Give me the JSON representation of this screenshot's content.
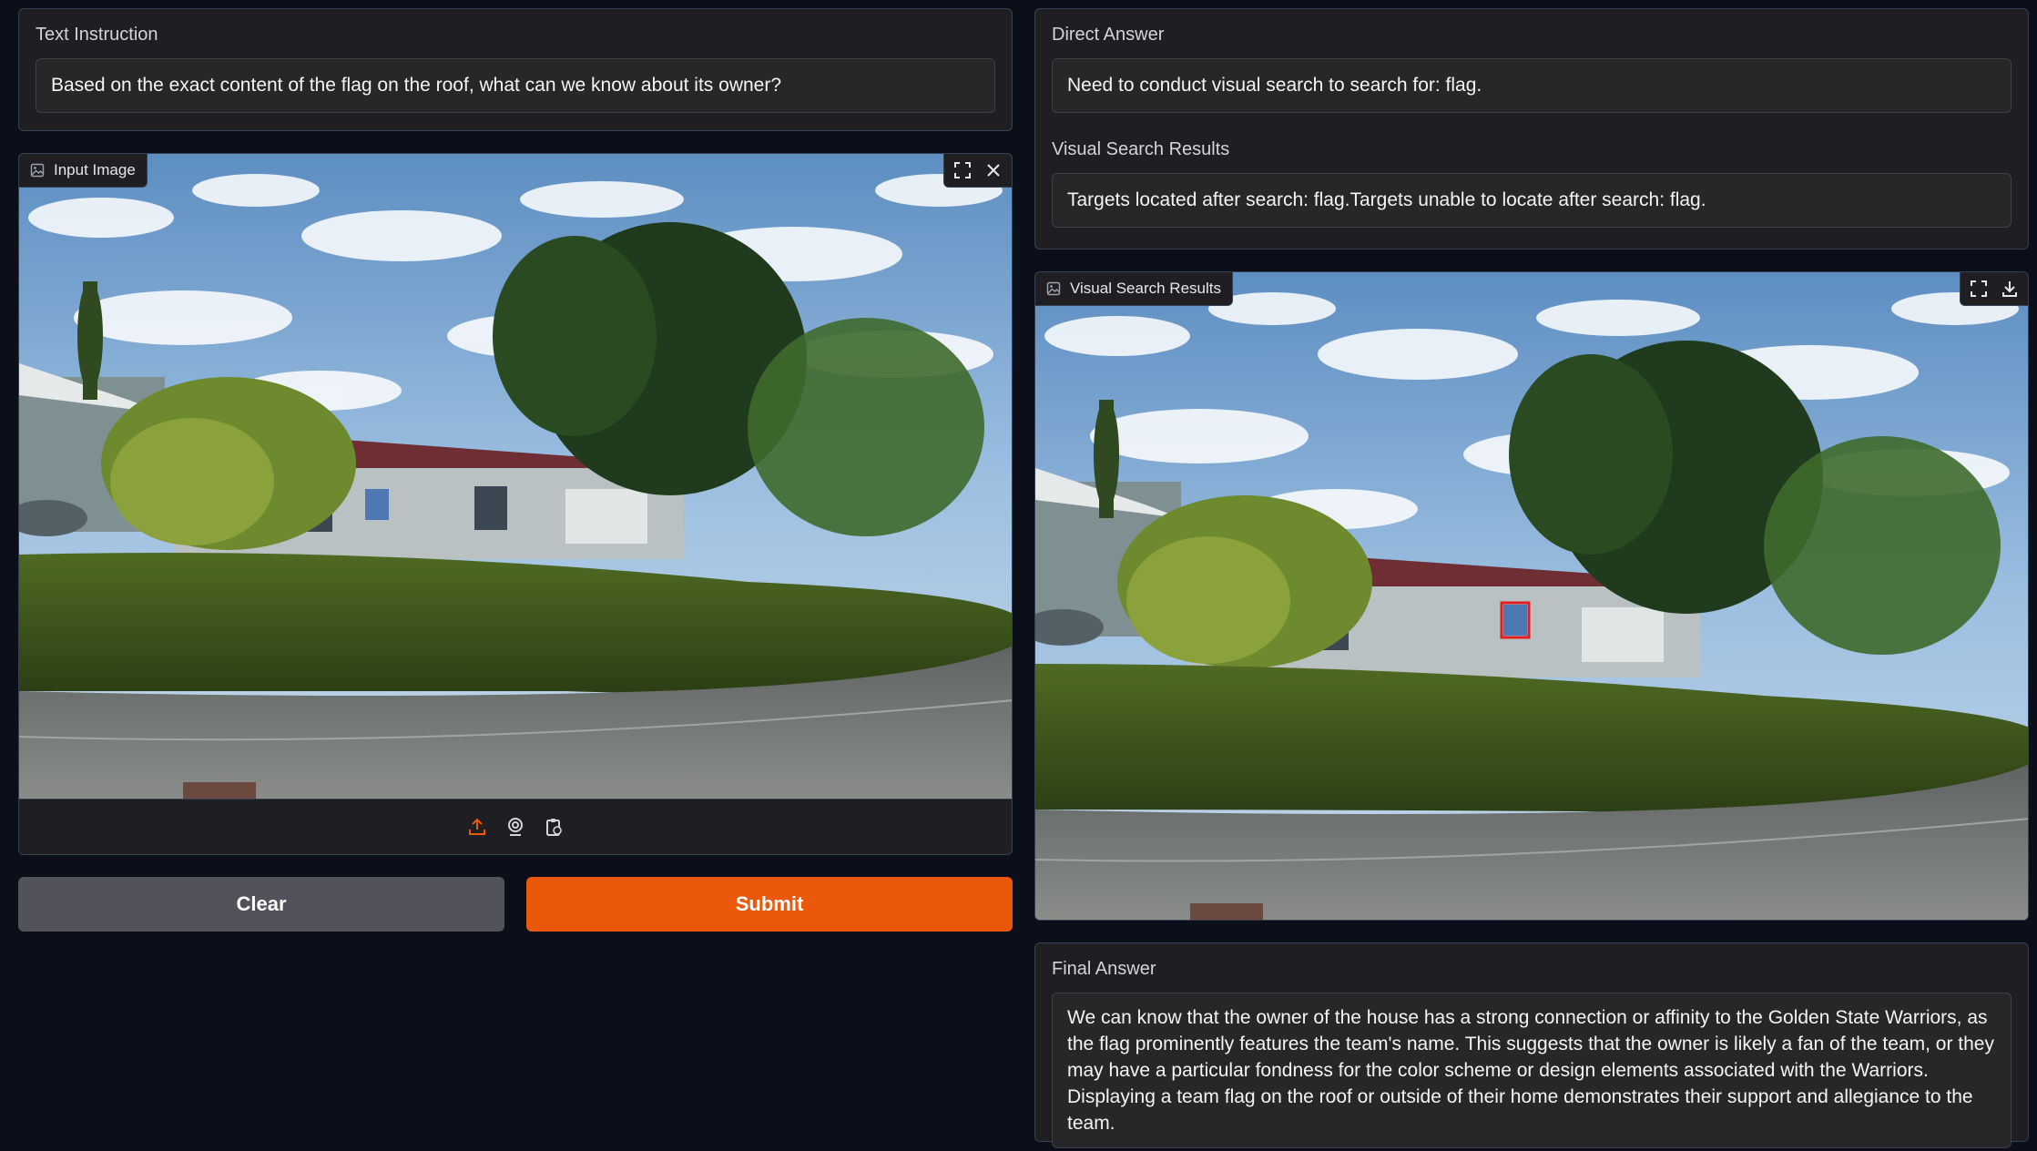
{
  "instruction": {
    "label": "Text Instruction",
    "value": "Based on the exact content of the flag on the roof, what can we know about its owner?"
  },
  "input_image": {
    "label": "Input Image"
  },
  "buttons": {
    "clear": "Clear",
    "submit": "Submit"
  },
  "direct_answer": {
    "label": "Direct Answer",
    "value": "Need to conduct visual search to search for: flag."
  },
  "search_results": {
    "label": "Visual Search Results",
    "value": "Targets located after search: flag.Targets unable to locate after search: flag."
  },
  "result_image": {
    "label": "Visual Search Results"
  },
  "final_answer": {
    "label": "Final Answer",
    "value": "We can know that the owner of the house has a strong connection or affinity to the Golden State Warriors, as the flag prominently features the team's name. This suggests that the owner is likely a fan of the team, or they may have a particular fondness for the color scheme or design elements associated with the Warriors. Displaying a team flag on the roof or outside of their home demonstrates their support and allegiance to the team."
  },
  "colors": {
    "background": "#0b0f19",
    "panel": "#1f1f23",
    "accent": "#ea580c",
    "secondary_button": "#52525b"
  }
}
